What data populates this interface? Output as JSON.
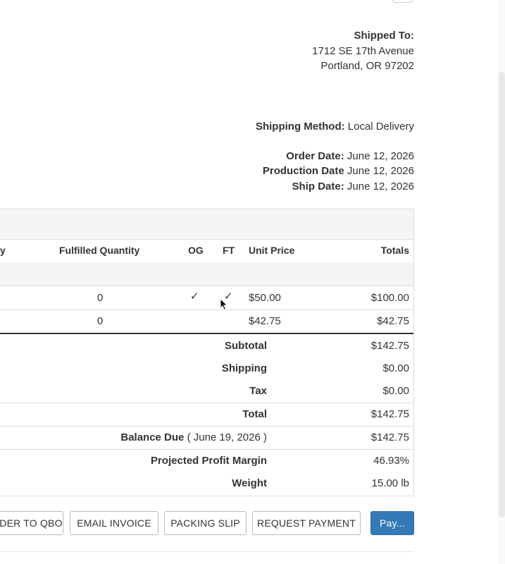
{
  "shipped_to": {
    "label": "Shipped To:",
    "line1": "1712 SE 17th Avenue",
    "line2": "Portland, OR 97202"
  },
  "shipping_method": {
    "label": "Shipping Method:",
    "value": "Local Delivery"
  },
  "dates": {
    "order_label": "Order Date:",
    "order_value": "June 12, 2026",
    "production_label": "Production Date",
    "production_value": "June 12, 2026",
    "ship_label": "Ship Date:",
    "ship_value": "June 12, 2026"
  },
  "table": {
    "headers": {
      "quantity_partial": "y",
      "fulfilled": "Fulfilled Quantity",
      "og": "OG",
      "ft": "FT",
      "unit_price": "Unit Price",
      "totals": "Totals"
    },
    "rows": [
      {
        "fulfilled": "0",
        "og": "✓",
        "ft": "✓",
        "unit_price": "$50.00",
        "total": "$100.00"
      },
      {
        "fulfilled": "0",
        "og": "",
        "ft": "",
        "unit_price": "$42.75",
        "total": "$42.75"
      }
    ]
  },
  "summary": {
    "subtotal_label": "Subtotal",
    "subtotal_value": "$142.75",
    "shipping_label": "Shipping",
    "shipping_value": "$0.00",
    "tax_label": "Tax",
    "tax_value": "$0.00",
    "total_label": "Total",
    "total_value": "$142.75",
    "balance_label": "Balance Due",
    "balance_date": "( June 19, 2026 )",
    "balance_value": "$142.75",
    "margin_label": "Projected Profit Margin",
    "margin_value": "46.93%",
    "weight_label": "Weight",
    "weight_value": "15.00 lb"
  },
  "buttons": {
    "qbo": "DER TO QBO",
    "email_invoice": "EMAIL INVOICE",
    "packing_slip": "PACKING SLIP",
    "request_payment": "REQUEST PAYMENT",
    "pay": "Pay..."
  },
  "colors": {
    "primary": "#337ab7",
    "border": "#dddddd",
    "band": "#f5f5f5"
  }
}
